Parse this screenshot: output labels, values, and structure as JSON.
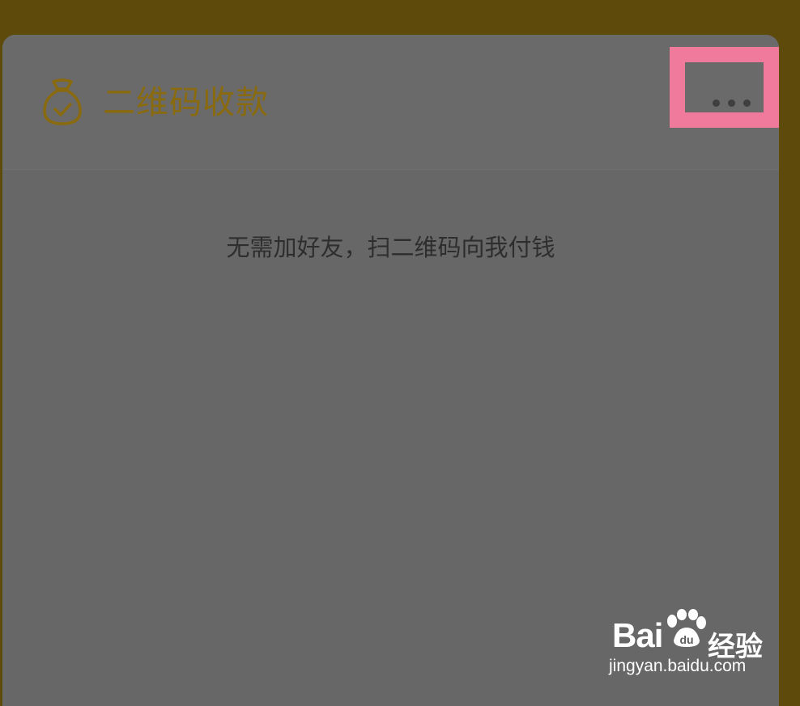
{
  "header": {
    "title": "二维码收款",
    "more_label": "..."
  },
  "main": {
    "subtitle": "无需加好友，扫二维码向我付钱"
  },
  "icons": {
    "header_icon": "money-bag-icon",
    "more_icon": "more-dots-icon"
  },
  "colors": {
    "accent": "#8a6a0f",
    "background": "#5e4a0b",
    "card": "#676767",
    "highlight": "#f07a9b"
  },
  "watermark": {
    "brand": "Bai du 经验",
    "url": "jingyan.baidu.com"
  }
}
